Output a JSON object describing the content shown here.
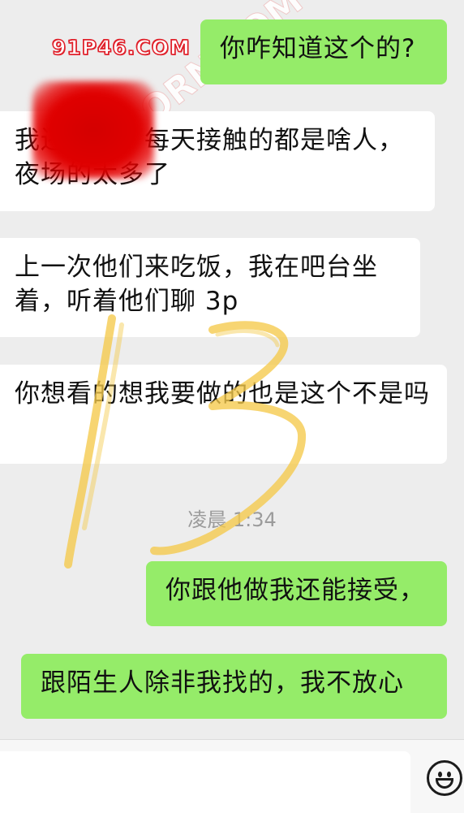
{
  "watermark": {
    "site": "91P46.COM",
    "diagonal": "91PORN.COM"
  },
  "annotation": "13",
  "messages": [
    {
      "id": "b1",
      "side": "out",
      "text": "你咋知道这个的?"
    },
    {
      "id": "b2",
      "side": "in",
      "text": "我还要看，每天接触的都是啥人，夜场的太多了"
    },
    {
      "id": "b3",
      "side": "in",
      "text": "上一次他们来吃饭，我在吧台坐着，听着他们聊 3p"
    },
    {
      "id": "b4",
      "side": "in",
      "text": "你想看的想我要做的也是这个不是吗"
    },
    {
      "id": "b5",
      "side": "out",
      "text": "你跟他做我还能接受，"
    },
    {
      "id": "b6",
      "side": "out",
      "text": "跟陌生人除非我找的，我不放心"
    }
  ],
  "timestamp": "凌晨 1:34",
  "input_bar": {
    "value": "",
    "placeholder": ""
  },
  "icons": {
    "emoji": "emoji-smile-icon"
  },
  "colors": {
    "background": "#ededed",
    "outgoing_bubble": "#95ec69",
    "incoming_bubble": "#ffffff",
    "watermark_red": "#e0202a",
    "annotation_yellow": "#f5c94a"
  }
}
